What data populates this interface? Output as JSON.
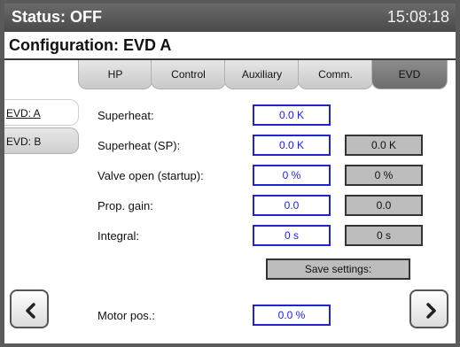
{
  "header": {
    "status": "Status: OFF",
    "time": "15:08:18"
  },
  "config": {
    "title": "Configuration: EVD A"
  },
  "tabs": [
    {
      "label": "HP"
    },
    {
      "label": "Control"
    },
    {
      "label": "Auxiliary"
    },
    {
      "label": "Comm."
    },
    {
      "label": "EVD",
      "active": true
    }
  ],
  "side_tabs": [
    {
      "label": "EVD: A",
      "active": true
    },
    {
      "label": "EVD: B"
    }
  ],
  "rows": {
    "superheat": {
      "label": "Superheat:",
      "value": "0.0 K"
    },
    "superheat_sp": {
      "label": "Superheat (SP):",
      "value": "0.0 K",
      "setpoint": "0.0 K"
    },
    "valve_open": {
      "label": "Valve open (startup):",
      "value": "0 %",
      "setpoint": "0 %"
    },
    "prop_gain": {
      "label": "Prop. gain:",
      "value": "0.0",
      "setpoint": "0.0"
    },
    "integral": {
      "label": "Integral:",
      "value": "0 s",
      "setpoint": "0 s"
    }
  },
  "save_button": "Save settings:",
  "motor": {
    "label": "Motor pos.:",
    "value": "0.0 %"
  },
  "nav": {
    "prev_icon": "chevron-left-icon",
    "next_icon": "chevron-right-icon"
  },
  "colors": {
    "header_bg": "#555555",
    "value_text": "#1a1aff",
    "value_border": "#2222cc",
    "setpoint_bg": "#bdbdbd"
  }
}
